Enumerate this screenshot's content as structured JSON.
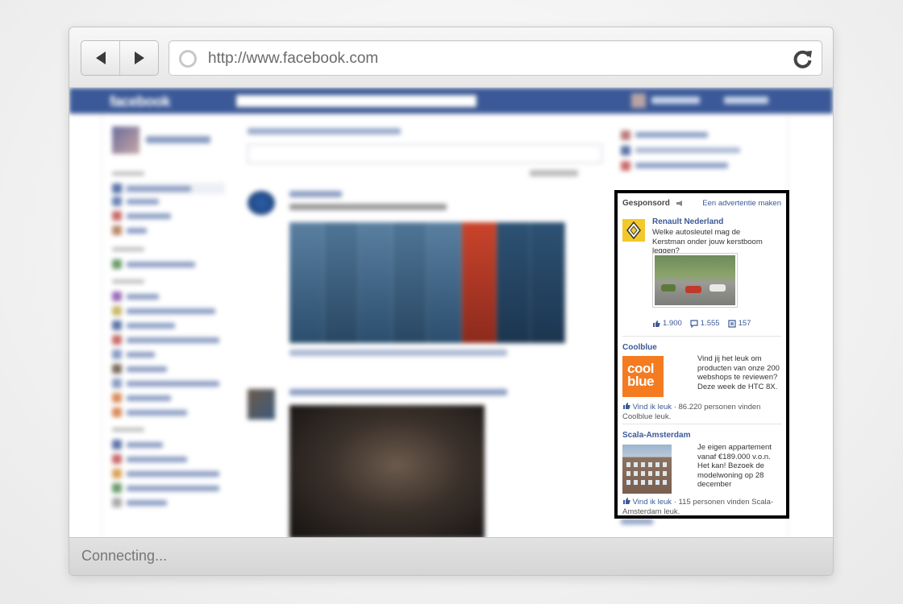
{
  "browser": {
    "url": "http://www.facebook.com",
    "status": "Connecting..."
  },
  "facebook": {
    "logo": "facebook"
  },
  "sponsored": {
    "title": "Gesponsord",
    "make_ad_link": "Een advertentie maken",
    "ads": [
      {
        "name": "Renault Nederland",
        "text": "Welke autosleutel mag de Kerstman onder jouw kerstboom leggen?",
        "likes": "1.900",
        "comments": "1.555",
        "shares": "157"
      },
      {
        "name": "Coolblue",
        "logo_text_1": "cool",
        "logo_text_2": "blue",
        "text": "Vind jij het leuk om producten van onze 200 webshops te reviewen? Deze week de HTC 8X.",
        "like_label": "Vind ik leuk",
        "social": " · 86.220 personen vinden Coolblue leuk."
      },
      {
        "name": "Scala-Amsterdam",
        "text": "Je eigen appartement vanaf €189.000 v.o.n. Het kan! Bezoek de modelwoning op 28 december",
        "like_label": "Vind ik leuk",
        "social": " · 115 personen vinden Scala-Amsterdam leuk."
      }
    ]
  },
  "colors": {
    "fb_blue": "#3b5998",
    "highlight_border": "#000000",
    "coolblue_orange": "#f47b20",
    "renault_yellow": "#f4c82a"
  }
}
